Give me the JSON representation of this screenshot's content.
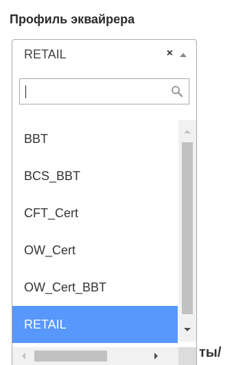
{
  "field": {
    "label": "Профиль эквайрера",
    "selected_value": "RETAIL",
    "clear_symbol": "×"
  },
  "dropdown": {
    "search_value": "",
    "items": [
      {
        "label": "BBT",
        "selected": false
      },
      {
        "label": "BCS_BBT",
        "selected": false
      },
      {
        "label": "CFT_Cert",
        "selected": false
      },
      {
        "label": "OW_Cert",
        "selected": false
      },
      {
        "label": "OW_Cert_BBT",
        "selected": false
      },
      {
        "label": "RETAIL",
        "selected": true
      }
    ]
  },
  "background": {
    "partial_text": "ты/"
  },
  "colors": {
    "selected_bg": "#5897fb",
    "border": "#a8a8a8",
    "scrollbar_thumb": "#c1c1c1"
  },
  "icons": {
    "clear": "close-icon",
    "toggle": "arrow-up-icon",
    "search": "search-icon"
  }
}
